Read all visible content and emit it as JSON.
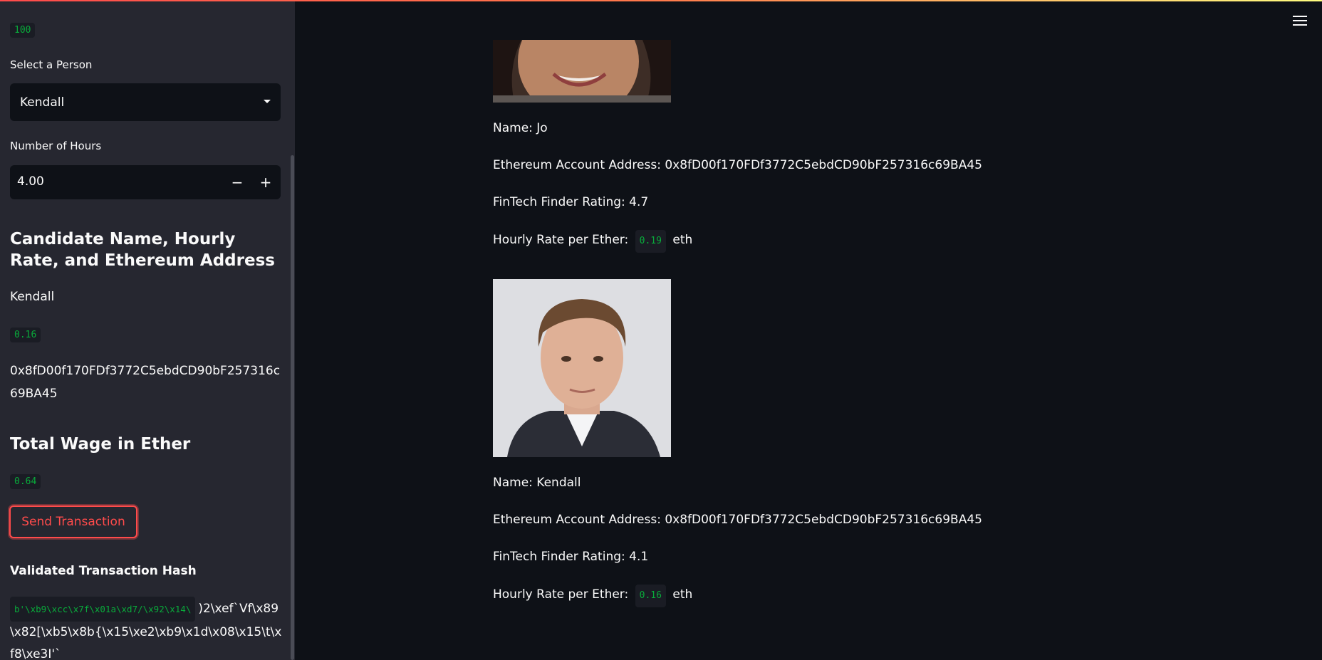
{
  "sidebar": {
    "top_value": "100",
    "select_label": "Select a Person",
    "select_value": "Kendall",
    "hours_label": "Number of Hours",
    "hours_value": "4.00",
    "candidate_heading": "Candidate Name, Hourly Rate, and Ethereum Address",
    "candidate_name": "Kendall",
    "candidate_rate": "0.16",
    "candidate_address": "0x8fD00f170FDf3772C5ebdCD90bF257316c69BA45",
    "wage_heading": "Total Wage in Ether",
    "wage_value": "0.64",
    "send_label": "Send Transaction",
    "hash_heading": "Validated Transaction Hash",
    "hash_code": "b'\\xb9\\xcc\\x7f\\x01a\\xd7/\\x92\\x14\\",
    "hash_rest": ")2\\xef`Vf\\x89\\x82[\\xb5\\x8b{\\x15\\xe2\\xb9\\x1d\\x08\\x15\\t\\xf8\\xe3I'`"
  },
  "candidates": [
    {
      "name_line": "Name: Jo",
      "address_line": "Ethereum Account Address: 0x8fD00f170FDf3772C5ebdCD90bF257316c69BA45",
      "rating_line": "FinTech Finder Rating: 4.7",
      "rate_prefix": "Hourly Rate per Ether:",
      "rate_value": "0.19",
      "rate_suffix": "eth"
    },
    {
      "name_line": "Name: Kendall",
      "address_line": "Ethereum Account Address: 0x8fD00f170FDf3772C5ebdCD90bF257316c69BA45",
      "rating_line": "FinTech Finder Rating: 4.1",
      "rate_prefix": "Hourly Rate per Ether:",
      "rate_value": "0.16",
      "rate_suffix": "eth"
    }
  ],
  "icons": {
    "menu": "hamburger-menu-icon"
  }
}
